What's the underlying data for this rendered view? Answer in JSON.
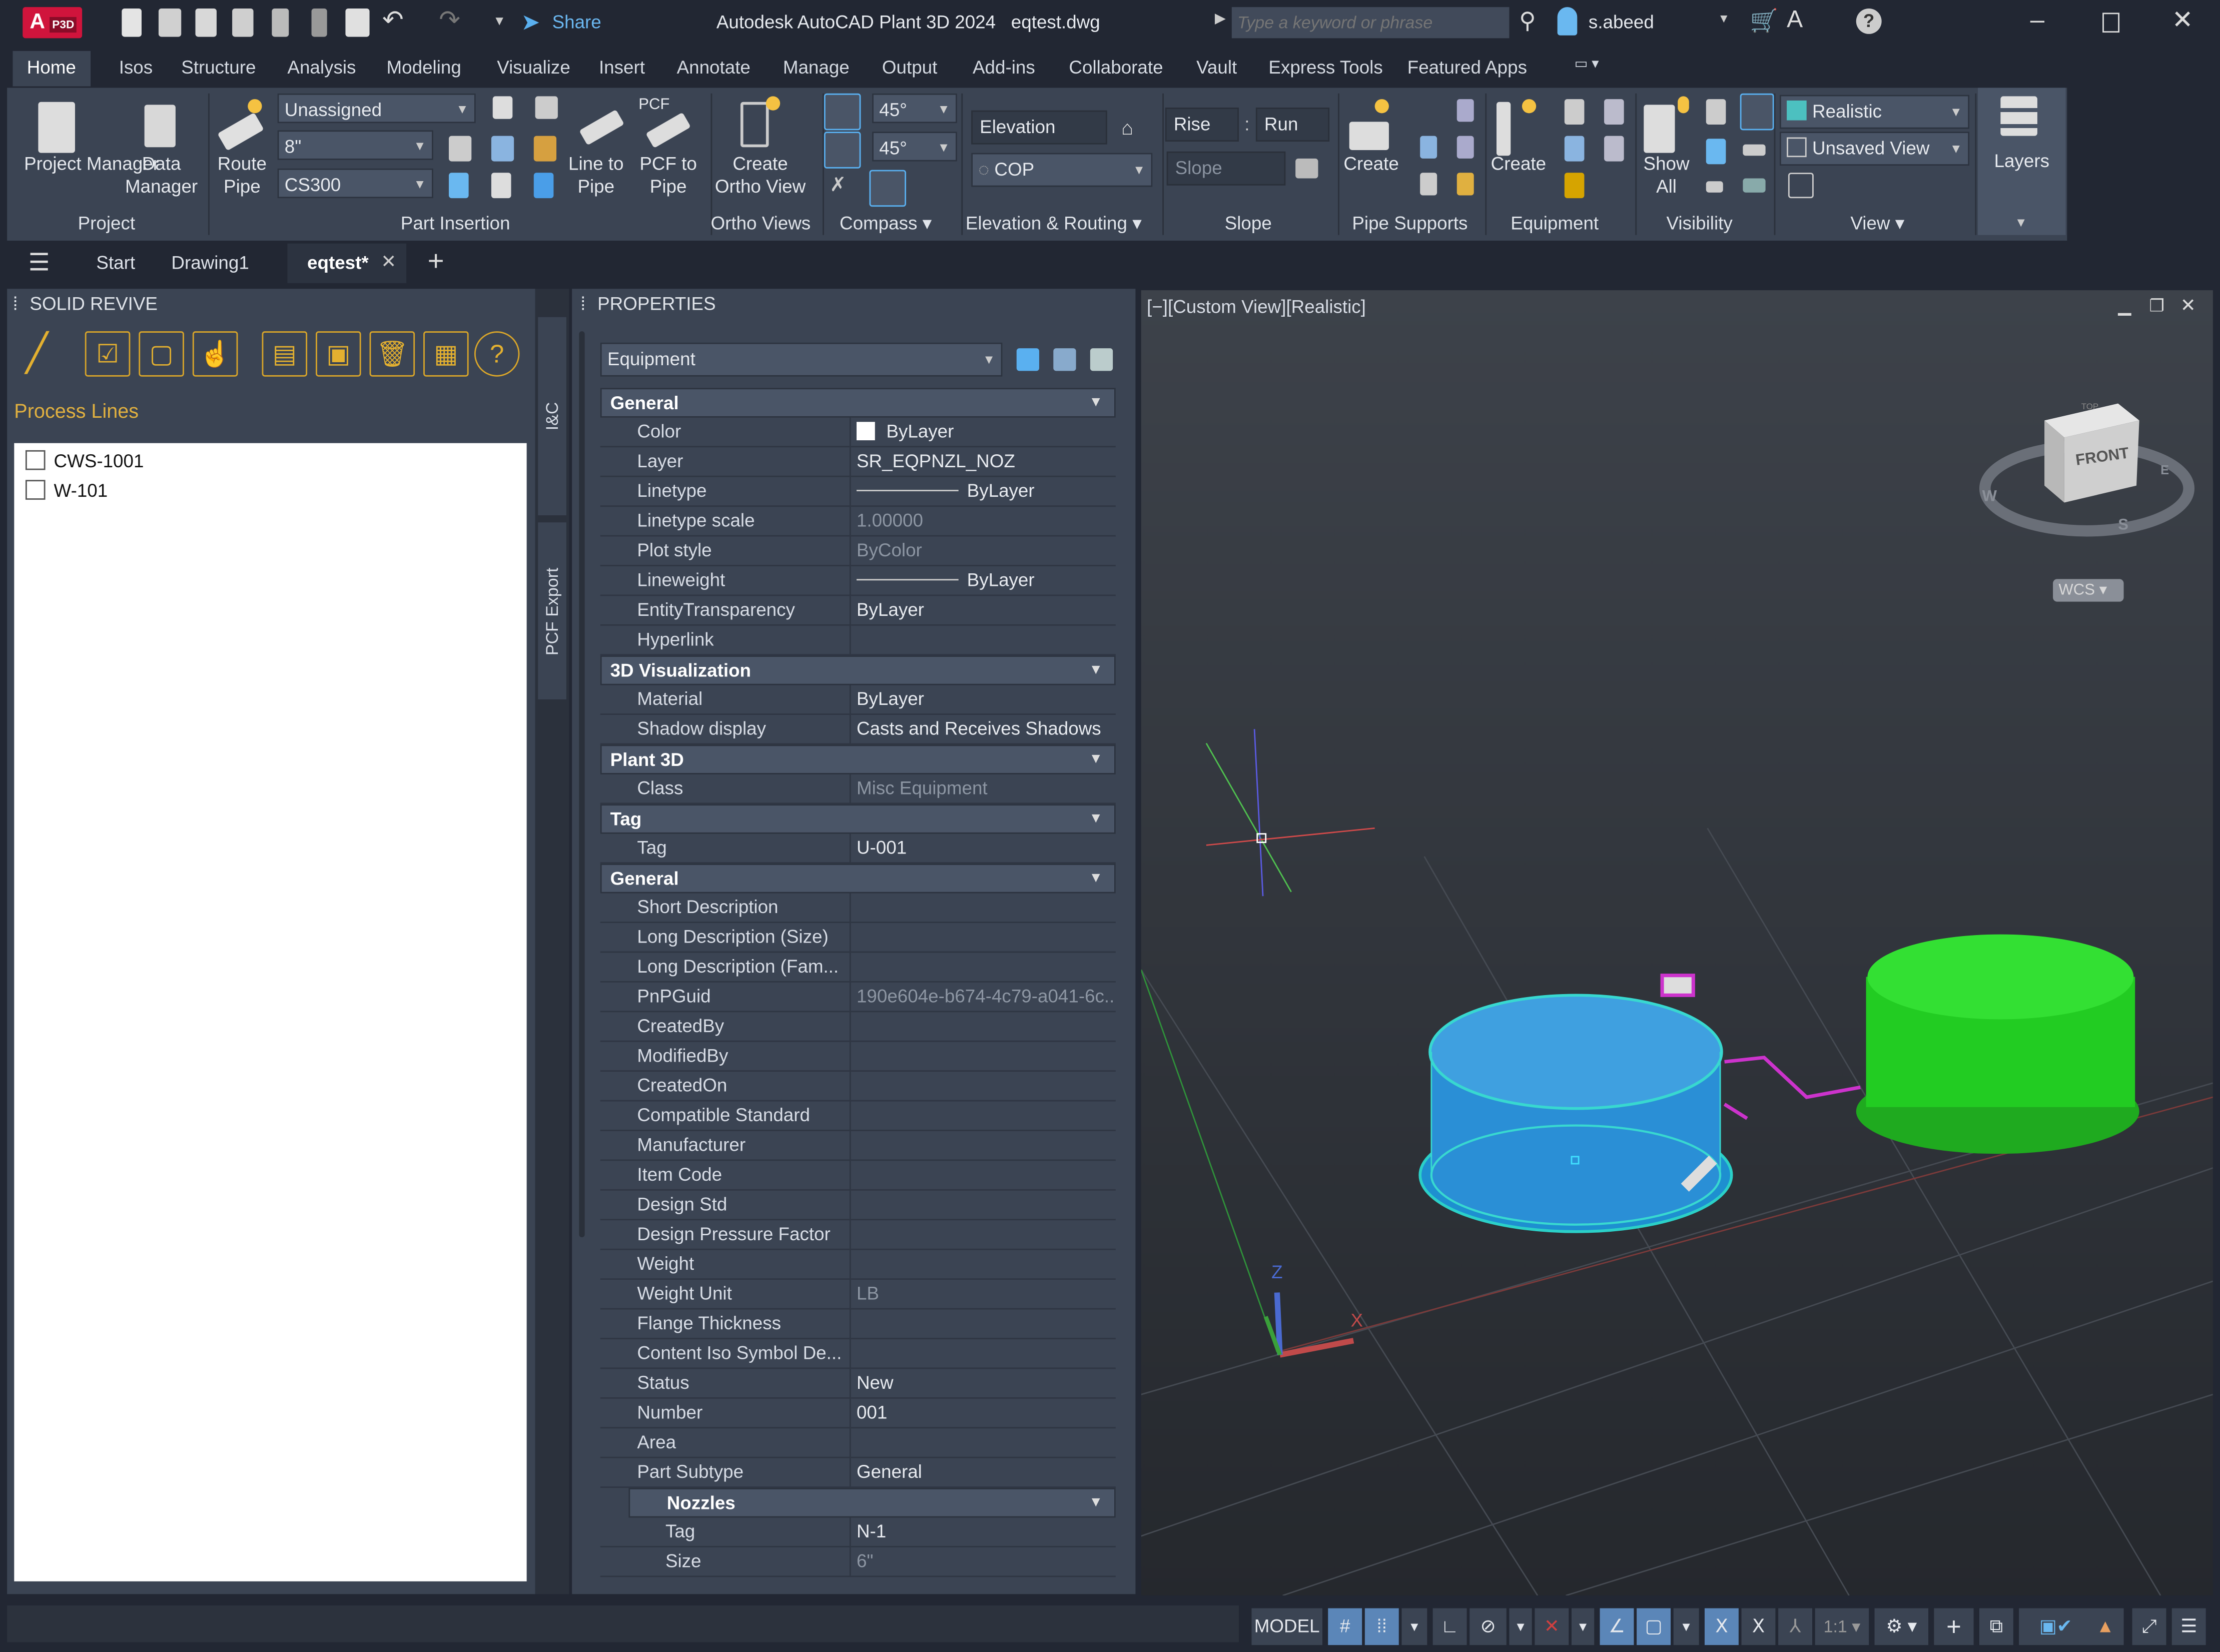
{
  "app": {
    "title": "Autodesk AutoCAD Plant 3D 2024",
    "filename": "eqtest.dwg",
    "logo_text": "A P3D",
    "share_label": "Share",
    "search_placeholder": "Type a keyword or phrase",
    "user": "s.abeed"
  },
  "ribbon_tabs": [
    "Home",
    "Isos",
    "Structure",
    "Analysis",
    "Modeling",
    "Visualize",
    "Insert",
    "Annotate",
    "Manage",
    "Output",
    "Add-ins",
    "Collaborate",
    "Vault",
    "Express Tools",
    "Featured Apps"
  ],
  "ribbon": {
    "project": {
      "label": "Project",
      "project_manager": "Project Manager",
      "data_manager": "Data Manager"
    },
    "part_insertion": {
      "label": "Part Insertion",
      "route_pipe": "Route Pipe",
      "service": "Unassigned",
      "size": "8\"",
      "spec": "CS300",
      "line_to_pipe": "Line to Pipe",
      "pcf_to_pipe": "PCF to Pipe",
      "pcf_badge": "PCF"
    },
    "ortho": {
      "label": "Ortho Views",
      "create": "Create Ortho View"
    },
    "compass": {
      "label": "Compass",
      "angle1": "45°",
      "angle2": "45°"
    },
    "elevation": {
      "label": "Elevation & Routing",
      "elevation": "Elevation",
      "cop": "COP"
    },
    "slope": {
      "label": "Slope",
      "rise": "Rise",
      "run": "Run",
      "slope": "Slope"
    },
    "pipe_supports": {
      "label": "Pipe Supports",
      "create": "Create"
    },
    "equipment": {
      "label": "Equipment",
      "create": "Create"
    },
    "visibility": {
      "label": "Visibility",
      "show_all": "Show All"
    },
    "view": {
      "label": "View",
      "visual_style": "Realistic",
      "named_view": "Unsaved View"
    },
    "layers": {
      "label": "Layers"
    }
  },
  "doc_tabs": [
    "Start",
    "Drawing1",
    "eqtest*"
  ],
  "solid_revive": {
    "title": "SOLID REVIVE",
    "section": "Process Lines",
    "lines": [
      "CWS-1001",
      "W-101"
    ]
  },
  "side_tabs": [
    "I&C",
    "PCF Export"
  ],
  "properties": {
    "title": "PROPERTIES",
    "object_type": "Equipment",
    "rows": [
      {
        "h": "General"
      },
      {
        "l": "Color",
        "v": "ByLayer",
        "swatch": "#ffffff"
      },
      {
        "l": "Layer",
        "v": "SR_EQPNZL_NOZ"
      },
      {
        "l": "Linetype",
        "v": "ByLayer",
        "line": true
      },
      {
        "l": "Linetype scale",
        "v": "1.00000",
        "muted": true
      },
      {
        "l": "Plot style",
        "v": "ByColor",
        "muted": true
      },
      {
        "l": "Lineweight",
        "v": "ByLayer",
        "line": true
      },
      {
        "l": "EntityTransparency",
        "v": "ByLayer"
      },
      {
        "l": "Hyperlink",
        "v": ""
      },
      {
        "h": "3D Visualization"
      },
      {
        "l": "Material",
        "v": "ByLayer"
      },
      {
        "l": "Shadow display",
        "v": "Casts and Receives Shadows"
      },
      {
        "h": "Plant 3D"
      },
      {
        "l": "Class",
        "v": "Misc Equipment",
        "muted": true
      },
      {
        "h": "Tag"
      },
      {
        "l": "Tag",
        "v": "U-001"
      },
      {
        "h": "General"
      },
      {
        "l": "Short Description",
        "v": ""
      },
      {
        "l": "Long Description (Size)",
        "v": ""
      },
      {
        "l": "Long Description (Fam...",
        "v": ""
      },
      {
        "l": "PnPGuid",
        "v": "190e604e-b674-4c79-a041-6c...",
        "muted": true
      },
      {
        "l": "CreatedBy",
        "v": ""
      },
      {
        "l": "ModifiedBy",
        "v": ""
      },
      {
        "l": "CreatedOn",
        "v": ""
      },
      {
        "l": "Compatible Standard",
        "v": ""
      },
      {
        "l": "Manufacturer",
        "v": ""
      },
      {
        "l": "Item Code",
        "v": ""
      },
      {
        "l": "Design Std",
        "v": ""
      },
      {
        "l": "Design Pressure Factor",
        "v": ""
      },
      {
        "l": "Weight",
        "v": ""
      },
      {
        "l": "Weight Unit",
        "v": "LB",
        "muted": true
      },
      {
        "l": "Flange Thickness",
        "v": ""
      },
      {
        "l": "Content Iso Symbol De...",
        "v": ""
      },
      {
        "l": "Status",
        "v": "New"
      },
      {
        "l": "Number",
        "v": "001"
      },
      {
        "l": "Area",
        "v": ""
      },
      {
        "l": "Part Subtype",
        "v": "General"
      },
      {
        "h": "Nozzles",
        "sub": true
      },
      {
        "l": "Tag",
        "v": "N-1",
        "sub": true
      },
      {
        "l": "Size",
        "v": "6\"",
        "sub": true,
        "muted": true
      }
    ]
  },
  "viewport": {
    "label": "[−][Custom View][Realistic]",
    "viewcube_face": "FRONT",
    "viewcube_top": "TOP",
    "compass": {
      "w": "W",
      "s": "S",
      "e": "E"
    },
    "ucs_label": "WCS",
    "axis_z": "Z",
    "axis_x": "X"
  },
  "statusbar": {
    "model": "MODEL",
    "scale": "1:1"
  },
  "colors": {
    "accent": "#5b86b8",
    "equipment_selected": "#2f8fd8",
    "equipment": "#22cc22",
    "pipe": "#cc33cc",
    "section_label": "#e0b040"
  }
}
